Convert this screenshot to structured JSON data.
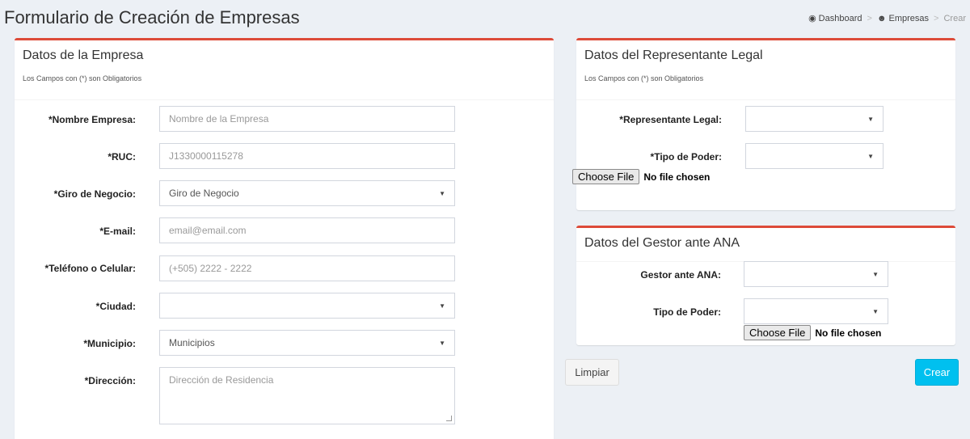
{
  "header": {
    "title": "Formulario de Creación de Empresas",
    "breadcrumb": [
      {
        "label": "Dashboard",
        "icon": "dashboard-icon"
      },
      {
        "label": "Empresas",
        "icon": "users-icon"
      },
      {
        "label": "Crear"
      }
    ],
    "separator": ">"
  },
  "empresa": {
    "title": "Datos de la Empresa",
    "subtitle": "Los Campos con (*) son Obligatorios",
    "fields": {
      "nombre": {
        "label": "*Nombre Empresa:",
        "placeholder": "Nombre de la Empresa"
      },
      "ruc": {
        "label": "*RUC:",
        "placeholder": "J1330000115278"
      },
      "giro": {
        "label": "*Giro de Negocio:",
        "value": "Giro de Negocio"
      },
      "email": {
        "label": "*E-mail:",
        "placeholder": "email@email.com"
      },
      "telefono": {
        "label": "*Teléfono o Celular:",
        "placeholder": "(+505) 2222 - 2222"
      },
      "ciudad": {
        "label": "*Ciudad:",
        "value": ""
      },
      "municipio": {
        "label": "*Municipio:",
        "value": "Municipios"
      },
      "direccion": {
        "label": "*Dirección:",
        "placeholder": "Dirección de Residencia"
      }
    }
  },
  "representante": {
    "title": "Datos del Representante Legal",
    "subtitle": "Los Campos con (*) son Obligatorios",
    "fields": {
      "representante": {
        "label": "*Representante Legal:",
        "value": ""
      },
      "tipo_poder": {
        "label": "*Tipo de Poder:",
        "value": ""
      }
    },
    "file": {
      "button": "Choose File",
      "status": "No file chosen"
    }
  },
  "gestor": {
    "title": "Datos del Gestor ante ANA",
    "fields": {
      "gestor": {
        "label": "Gestor ante ANA:",
        "value": ""
      },
      "tipo_poder": {
        "label": "Tipo de Poder:",
        "value": ""
      }
    },
    "file": {
      "button": "Choose File",
      "status": "No file chosen"
    }
  },
  "actions": {
    "clear_label": "Limpiar",
    "create_label": "Crear"
  },
  "colors": {
    "box_border": "#dd4b39",
    "create_button": "#00c0ef",
    "background": "#ecf0f5"
  }
}
